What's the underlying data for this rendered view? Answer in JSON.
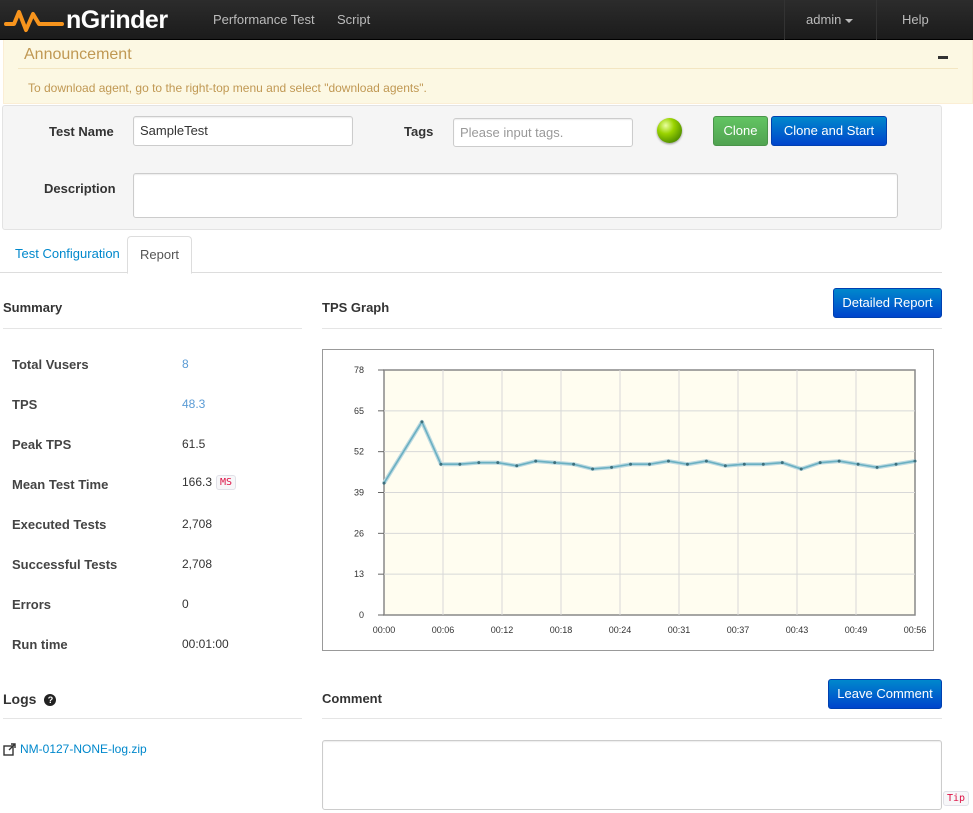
{
  "nav": {
    "brand": "nGrinder",
    "links": [
      "Performance Test",
      "Script"
    ],
    "user": "admin",
    "help": "Help"
  },
  "announcement": {
    "title": "Announcement",
    "text": "To download agent, go to the right-top menu and select \"download agents\"."
  },
  "form": {
    "test_name_label": "Test Name",
    "test_name_value": "SampleTest",
    "tags_label": "Tags",
    "tags_placeholder": "Please input tags.",
    "description_label": "Description",
    "clone_label": "Clone",
    "clone_start_label": "Clone and Start",
    "status_color": "#7fc600"
  },
  "tabs": [
    "Test Configuration",
    "Report"
  ],
  "summary": {
    "title": "Summary",
    "rows": [
      {
        "label": "Total Vusers",
        "value": "8"
      },
      {
        "label": "TPS",
        "value": "48.3"
      },
      {
        "label": "Peak TPS",
        "value": "61.5"
      },
      {
        "label": "Mean Test Time",
        "value": "166.3",
        "unit": "MS"
      },
      {
        "label": "Executed Tests",
        "value": "2,708"
      },
      {
        "label": "Successful Tests",
        "value": "2,708"
      },
      {
        "label": "Errors",
        "value": "0"
      },
      {
        "label": "Run time",
        "value": "00:01:00"
      }
    ]
  },
  "graph": {
    "title": "TPS Graph",
    "detailed_report_label": "Detailed Report"
  },
  "chart_data": {
    "type": "line",
    "title": "",
    "xlabel": "",
    "ylabel": "",
    "x_ticks": [
      "00:00",
      "00:06",
      "00:12",
      "00:18",
      "00:24",
      "00:31",
      "00:37",
      "00:43",
      "00:49",
      "00:56"
    ],
    "y_ticks": [
      0,
      13,
      26,
      39,
      52,
      65,
      78
    ],
    "ylim": [
      0,
      78
    ],
    "xlim": [
      0,
      56
    ],
    "grid": true,
    "line_color": "#6ab0c2",
    "series": [
      {
        "x": [
          0,
          4,
          6,
          8,
          10,
          12,
          14,
          16,
          18,
          20,
          22,
          24,
          26,
          28,
          30,
          32,
          34,
          36,
          38,
          40,
          42,
          44,
          46,
          48,
          50,
          52,
          54,
          56
        ],
        "values": [
          42,
          61.5,
          48,
          48,
          48.5,
          48.5,
          47.5,
          49,
          48.5,
          48,
          46.5,
          47,
          48,
          48,
          49,
          48,
          49,
          47.5,
          48,
          48,
          48.5,
          46.5,
          48.5,
          49,
          48,
          47,
          48,
          49
        ]
      }
    ]
  },
  "logs": {
    "title": "Logs",
    "file": "NM-0127-NONE-log.zip"
  },
  "comment": {
    "title": "Comment",
    "button_label": "Leave Comment",
    "tip": "Tip"
  }
}
